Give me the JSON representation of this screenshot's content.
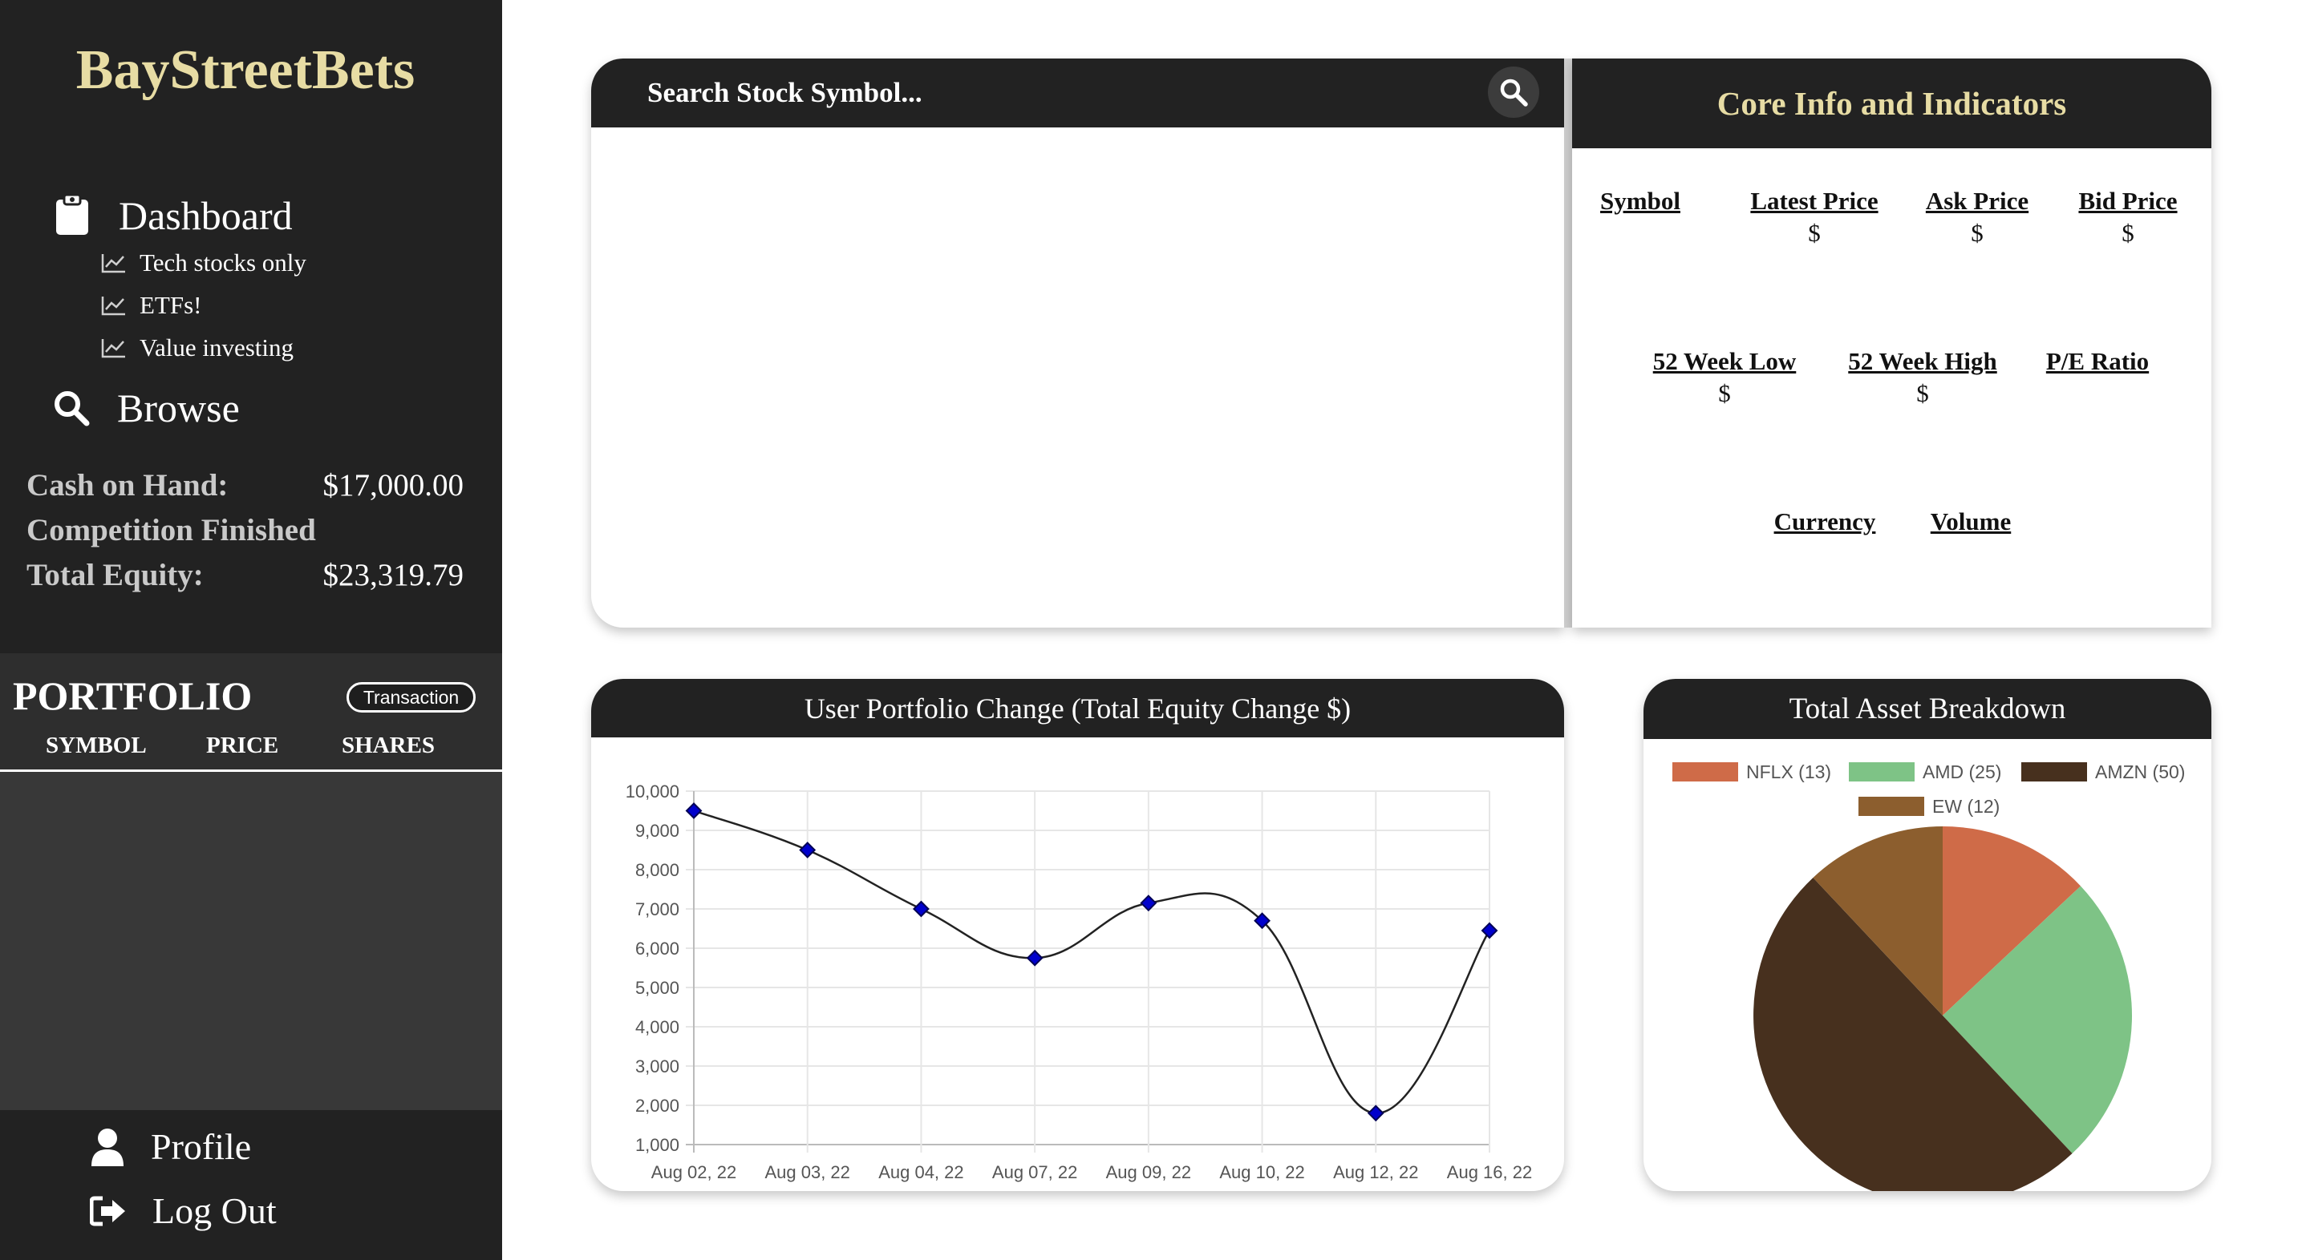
{
  "sidebar": {
    "brand": "BayStreetBets",
    "nav": {
      "dashboard": "Dashboard",
      "browse": "Browse",
      "profile": "Profile",
      "logout": "Log Out"
    },
    "sub_items": [
      "Tech stocks only",
      "ETFs!",
      "Value investing"
    ],
    "stats": {
      "cash_label": "Cash on Hand:",
      "cash_value": "$17,000.00",
      "status": "Competition Finished",
      "equity_label": "Total Equity:",
      "equity_value": "$23,319.79"
    },
    "portfolio": {
      "title": "PORTFOLIO",
      "transaction_button": "Transaction",
      "columns": [
        "SYMBOL",
        "PRICE",
        "SHARES"
      ]
    }
  },
  "search": {
    "placeholder": "Search Stock Symbol..."
  },
  "core_info": {
    "title": "Core Info and Indicators",
    "row1": [
      {
        "label": "Symbol",
        "value": ""
      },
      {
        "label": "Latest Price",
        "value": "$"
      },
      {
        "label": "Ask Price",
        "value": "$"
      },
      {
        "label": "Bid Price",
        "value": "$"
      }
    ],
    "row2": [
      {
        "label": "52 Week Low",
        "value": "$"
      },
      {
        "label": "52 Week High",
        "value": "$"
      },
      {
        "label": "P/E Ratio",
        "value": ""
      }
    ],
    "row3": [
      {
        "label": "Currency",
        "value": ""
      },
      {
        "label": "Volume",
        "value": ""
      }
    ]
  },
  "colors": {
    "sidebar_bg": "#222222",
    "accent_gold": "#e7dca4",
    "line_marker": "#0000cc",
    "nflx": "#cf6b48",
    "amd": "#7ec386",
    "amzn": "#47301e",
    "ew": "#8c5e2e"
  },
  "icons": {
    "dashboard": "clipboard-icon",
    "sub_item": "chart-line-icon",
    "browse": "search-icon",
    "profile": "user-icon",
    "logout": "sign-out-icon",
    "search_button": "search-icon"
  },
  "chart_data": [
    {
      "type": "line",
      "title": "User Portfolio Change (Total Equity Change $)",
      "xlabel": "",
      "ylabel": "",
      "categories": [
        "Aug 02, 22",
        "Aug 03, 22",
        "Aug 04, 22",
        "Aug 07, 22",
        "Aug 09, 22",
        "Aug 10, 22",
        "Aug 12, 22",
        "Aug 16, 22"
      ],
      "values": [
        9500,
        8500,
        7000,
        5750,
        7150,
        6700,
        1800,
        6450
      ],
      "ylim": [
        1000,
        10000
      ],
      "yticks": [
        "1,000",
        "2,000",
        "3,000",
        "4,000",
        "5,000",
        "6,000",
        "7,000",
        "8,000",
        "9,000",
        "10,000"
      ],
      "grid": true,
      "smooth": true
    },
    {
      "type": "pie",
      "title": "Total Asset Breakdown",
      "legend_position": "top",
      "slices": [
        {
          "label": "NFLX (13)",
          "value": 13,
          "color": "#cf6b48"
        },
        {
          "label": "AMD (25)",
          "value": 25,
          "color": "#7ec386"
        },
        {
          "label": "AMZN (50)",
          "value": 50,
          "color": "#47301e"
        },
        {
          "label": "EW (12)",
          "value": 12,
          "color": "#8c5e2e"
        }
      ]
    }
  ]
}
